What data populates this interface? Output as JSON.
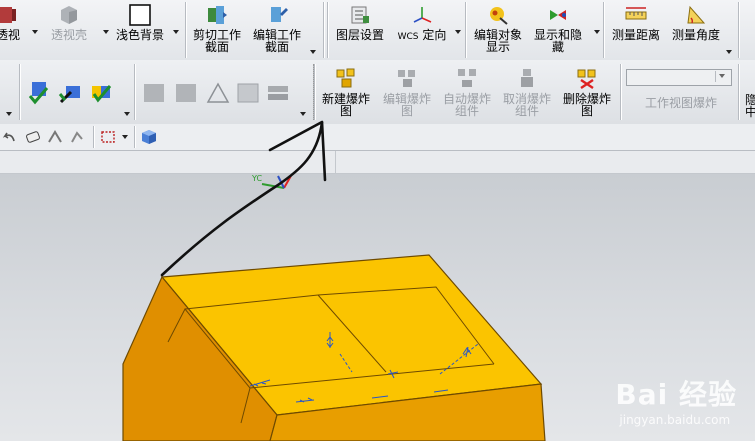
{
  "toolbar_top": {
    "buttons": [
      {
        "label": "透视",
        "name": "perspective-button"
      },
      {
        "label": "透视壳",
        "name": "perspective-shell-button"
      },
      {
        "label": "浅色背景",
        "name": "light-background-button"
      },
      {
        "label": "剪切工作\n截面",
        "name": "clip-work-section-button"
      },
      {
        "label": "编辑工作\n截面",
        "name": "edit-work-section-button"
      },
      {
        "label": "图层设置",
        "name": "layer-settings-button"
      },
      {
        "label": "定向",
        "name": "wcs-orient-button"
      },
      {
        "label": "编辑对象\n显示",
        "name": "edit-object-display-button"
      },
      {
        "label": "显示和隐\n藏",
        "name": "show-hide-button"
      },
      {
        "label": "测量距离",
        "name": "measure-distance-button"
      },
      {
        "label": "测量角度",
        "name": "measure-angle-button"
      }
    ],
    "wcs_prefix": "WCS"
  },
  "toolbar_exploded": {
    "buttons": [
      {
        "label": "新建爆炸\n图",
        "name": "new-explosion-button",
        "enabled": true
      },
      {
        "label": "编辑爆炸\n图",
        "name": "edit-explosion-button",
        "enabled": false
      },
      {
        "label": "自动爆炸\n组件",
        "name": "auto-explode-button",
        "enabled": false
      },
      {
        "label": "取消爆炸\n组件",
        "name": "unexplode-button",
        "enabled": false
      },
      {
        "label": "删除爆炸\n图",
        "name": "delete-explosion-button",
        "enabled": true
      }
    ],
    "work_view_label": "工作视图爆炸",
    "edge_label": "隐\n中"
  },
  "viewport": {
    "axis_label": "YC"
  },
  "watermark": {
    "main": "Bai 经验",
    "sub": "jingyan.baidu.com"
  },
  "colors": {
    "part_top": "#fbc400",
    "part_front": "#e49b00",
    "part_side": "#d98b00",
    "annotation_line": "#111111"
  }
}
